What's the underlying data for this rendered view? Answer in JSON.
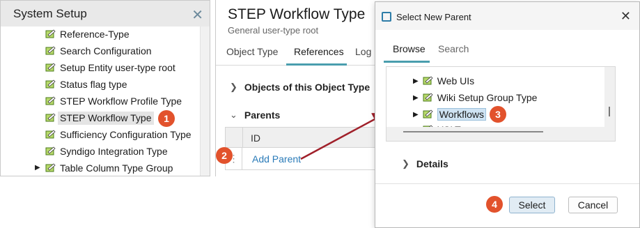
{
  "left_panel": {
    "title": "System Setup",
    "items": [
      {
        "label": "Reference-Type"
      },
      {
        "label": "Search Configuration"
      },
      {
        "label": "Setup Entity user-type root"
      },
      {
        "label": "Status flag type"
      },
      {
        "label": "STEP Workflow Profile Type"
      },
      {
        "label": "STEP Workflow Type"
      },
      {
        "label": "Sufficiency Configuration Type"
      },
      {
        "label": "Syndigo Integration Type"
      },
      {
        "label": "Table Column Type Group"
      }
    ]
  },
  "main": {
    "title": "STEP Workflow Type",
    "subtitle": "General user-type root",
    "tabs": [
      "Object Type",
      "References",
      "Log"
    ],
    "sections": {
      "objects": "Objects of this Object Type",
      "parents": "Parents"
    },
    "grid": {
      "header_id": "ID",
      "dots": "⋮",
      "add_parent": "Add Parent"
    }
  },
  "dialog": {
    "title": "Select New Parent",
    "close": "✕",
    "tabs": [
      "Browse",
      "Search"
    ],
    "items": [
      {
        "label": "Web UIs"
      },
      {
        "label": "Wiki Setup Group Type"
      },
      {
        "label": "Workflows"
      },
      {
        "label": "XSLT"
      }
    ],
    "details": "Details",
    "select_label": "Select",
    "cancel_label": "Cancel"
  },
  "badges": [
    "1",
    "2",
    "3",
    "4"
  ],
  "colors": {
    "accent_tab": "#4a9eae",
    "badge": "#e2522c",
    "link": "#2a7bb8",
    "arrow": "#a0202a"
  }
}
